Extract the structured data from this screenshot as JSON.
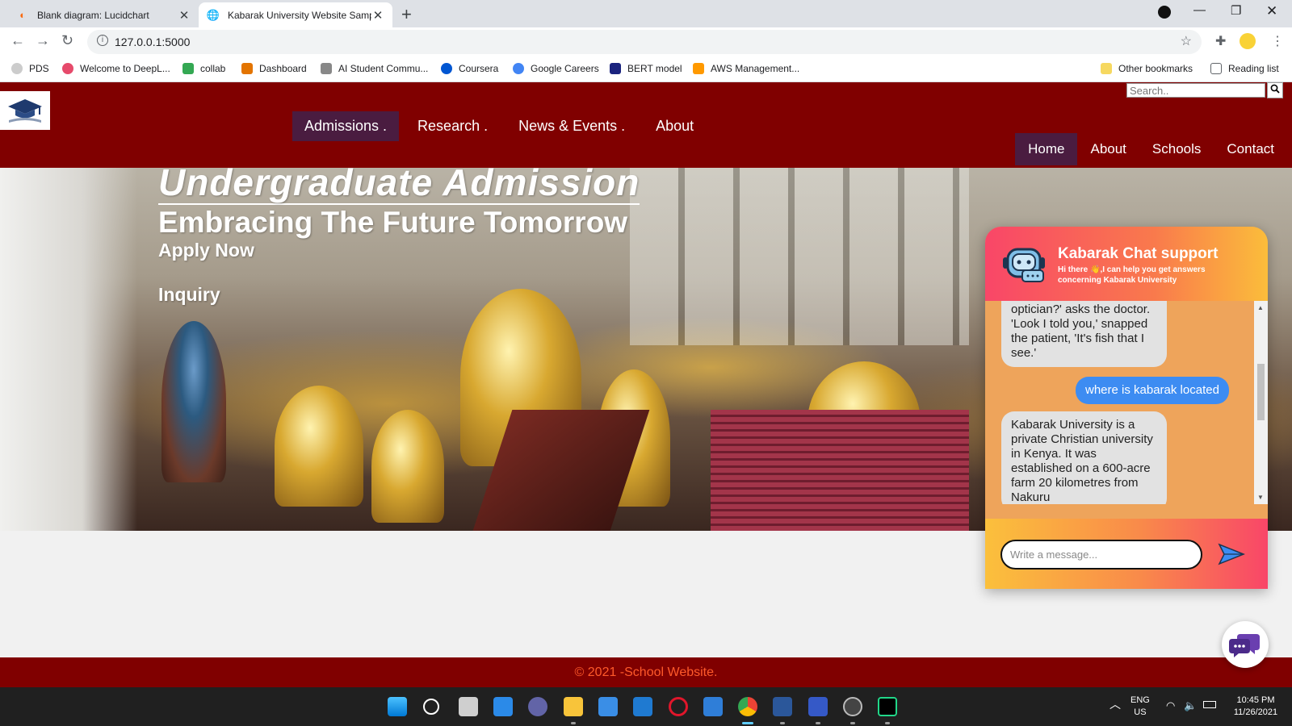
{
  "browser": {
    "tabs": [
      {
        "title": "Blank diagram: Lucidchart",
        "active": false
      },
      {
        "title": "Kabarak University Website Samp",
        "active": true
      }
    ],
    "url": "127.0.0.1:5000",
    "bookmarks": [
      {
        "label": "PDS",
        "icon": "github-icon",
        "color": "#cccccc"
      },
      {
        "label": "Welcome to DeepL...",
        "icon": "deepl-icon",
        "color": "#e64a6b"
      },
      {
        "label": "collab",
        "icon": "drive-icon",
        "color": "#34a853"
      },
      {
        "label": "Dashboard",
        "icon": "dashboard-icon",
        "color": "#e37400"
      },
      {
        "label": "AI Student Commu...",
        "icon": "ai-community-icon",
        "color": "#888888"
      },
      {
        "label": "Coursera",
        "icon": "coursera-icon",
        "color": "#0056d2"
      },
      {
        "label": "Google Careers",
        "icon": "google-icon",
        "color": "#4285f4"
      },
      {
        "label": "BERT model",
        "icon": "bert-icon",
        "color": "#1a237e"
      },
      {
        "label": "AWS Management...",
        "icon": "aws-icon",
        "color": "#ff9900"
      }
    ],
    "other_bookmarks": "Other bookmarks",
    "reading_list": "Reading list"
  },
  "header": {
    "main_nav": [
      "Admissions .",
      "Research .",
      "News & Events .",
      "About"
    ],
    "search_placeholder": "Search..",
    "sub_nav": [
      "Home",
      "About",
      "Schools",
      "Contact"
    ]
  },
  "hero": {
    "title": "Undergraduate Admission",
    "subtitle": "Embracing The Future Tomorrow",
    "apply": "Apply Now",
    "inquiry": "Inquiry"
  },
  "chat": {
    "title": "Kabarak Chat support",
    "greeting": "Hi there 👋,I can help you get answers concerning Kabarak University",
    "messages": [
      {
        "from": "bot",
        "text": "'Have you seen an optician?' asks the doctor. 'Look I told you,' snapped the patient, 'It's fish that I see.'"
      },
      {
        "from": "user",
        "text": "where is kabarak located"
      },
      {
        "from": "bot",
        "text": "Kabarak University is a private Christian university in Kenya. It was established on a 600-acre farm 20 kilometres from Nakuru"
      }
    ],
    "input_placeholder": "Write a message..."
  },
  "footer": {
    "text": "© 2021 -School Website."
  },
  "taskbar": {
    "language": "ENG",
    "region": "US",
    "time": "10:45 PM",
    "date": "11/26/2021"
  },
  "colors": {
    "brand": "#800000",
    "nav_active": "#4a1c40",
    "footer_text": "#ff5a2a",
    "chat_user_bubble": "#3d8cf2"
  }
}
